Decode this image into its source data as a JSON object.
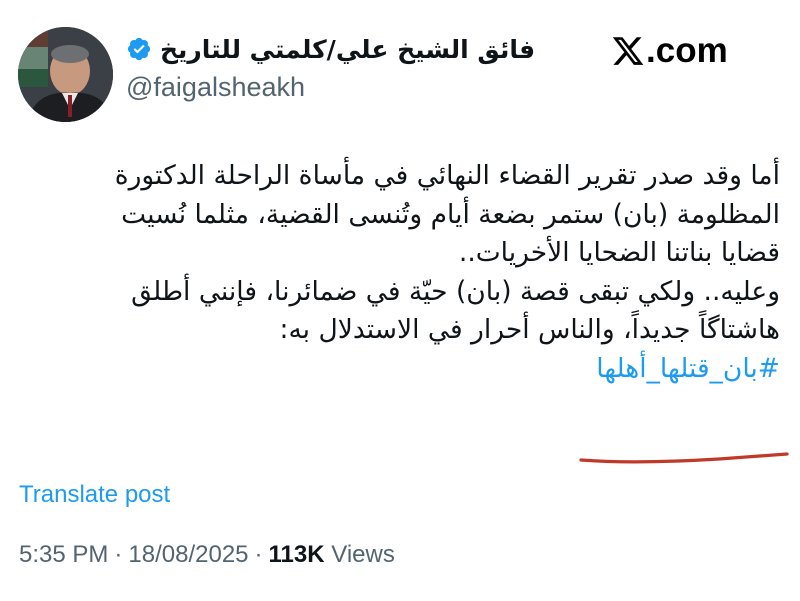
{
  "author": {
    "display_name": "فائق الشيخ علي/كلمتي للتاريخ",
    "handle": "@faigalsheakh",
    "verified": true
  },
  "brand": {
    "domain": ".com",
    "logo_icon": "x-logo-icon"
  },
  "post": {
    "lines": [
      "أما وقد صدر تقرير القضاء النهائي في مأساة الراحلة الدكتورة",
      "المظلومة (بان) ستمر بضعة أيام وتُنسى القضية، مثلما نُسيت",
      "قضايا بناتنا الضحايا الأخريات..",
      "وعليه.. ولكي تبقى قصة (بان) حيّة في ضمائرنا، فإنني أطلق",
      "هاشتاگاً جديداً، والناس أحرار في الاستدلال به:"
    ],
    "hashtag": "#بان_قتلها_أهلها"
  },
  "actions": {
    "translate_label": "Translate post"
  },
  "meta": {
    "time": "5:35 PM",
    "date": "18/08/2025",
    "separator": "·",
    "views_count": "113K",
    "views_label": "Views"
  },
  "colors": {
    "link": "#1d9bf0",
    "muted": "#536471",
    "text": "#0f1419",
    "verified_badge": "#1d9bf0",
    "annotation_underline": "#c0392b"
  }
}
